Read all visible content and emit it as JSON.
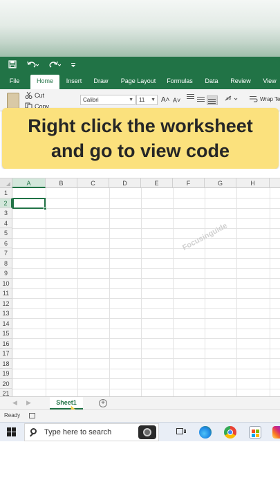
{
  "quick_access": {
    "save_icon": "save-icon",
    "undo_icon": "undo-icon",
    "redo_icon": "redo-icon"
  },
  "ribbon_tabs": [
    {
      "label": "File",
      "active": false
    },
    {
      "label": "Home",
      "active": true
    },
    {
      "label": "Insert",
      "active": false
    },
    {
      "label": "Draw",
      "active": false
    },
    {
      "label": "Page Layout",
      "active": false
    },
    {
      "label": "Formulas",
      "active": false
    },
    {
      "label": "Data",
      "active": false
    },
    {
      "label": "Review",
      "active": false
    },
    {
      "label": "View",
      "active": false
    }
  ],
  "ribbon": {
    "cut_label": "Cut",
    "copy_label": "Copy",
    "font_name": "Calibri",
    "font_size": "11",
    "grow_font": "A˄",
    "shrink_font": "A˅",
    "wrap_text_label": "Wrap Te"
  },
  "banner": {
    "line1": "Right click the worksheet",
    "line2": "and go to view code"
  },
  "grid": {
    "columns": [
      "A",
      "B",
      "C",
      "D",
      "E",
      "F",
      "G",
      "H"
    ],
    "rows": [
      "1",
      "2",
      "3",
      "4",
      "5",
      "6",
      "7",
      "8",
      "9",
      "10",
      "11",
      "12",
      "13",
      "14",
      "15",
      "16",
      "17",
      "18",
      "19",
      "20",
      "21"
    ],
    "selected_cell": "A2",
    "watermark": "Focusinguide"
  },
  "sheet_tabs": {
    "active": "Sheet1",
    "add_icon": "plus-circle-icon"
  },
  "status": {
    "ready": "Ready"
  },
  "taskbar": {
    "search_placeholder": "Type here to search",
    "icons": [
      "windows-start-icon",
      "search-icon",
      "camera-icon",
      "task-view-icon",
      "edge-icon",
      "chrome-icon",
      "store-icon",
      "instagram-icon"
    ]
  },
  "colors": {
    "excel_green": "#217346",
    "banner_yellow": "#fbe17d"
  }
}
